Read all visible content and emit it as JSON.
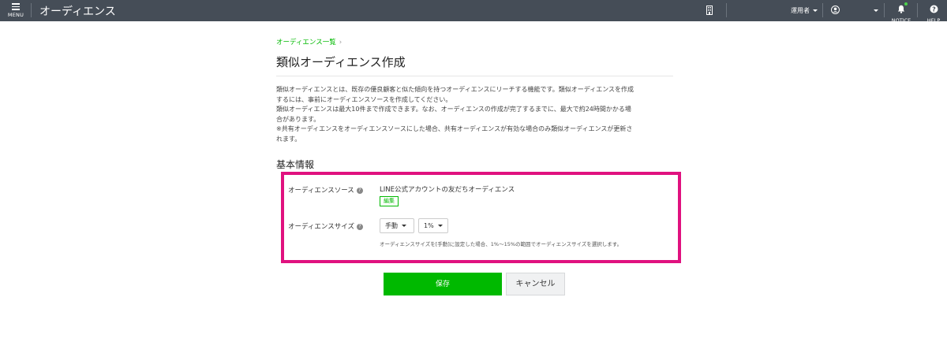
{
  "topbar": {
    "menu_label": "MENU",
    "app_title": "オーディエンス",
    "account_name": "運用者",
    "notice_label": "NOTICE",
    "help_label": "HELP",
    "icons": [
      "menu-icon",
      "building-icon",
      "user-icon",
      "bell-icon",
      "help-icon"
    ]
  },
  "breadcrumb": {
    "link": "オーディエンス一覧",
    "separator": "›"
  },
  "page": {
    "title": "類似オーディエンス作成",
    "description": [
      "類似オーディエンスとは、既存の優良顧客と似た傾向を持つオーディエンスにリーチする機能です。類似オーディエンスを作成",
      "するには、事前にオーディエンスソースを作成してください。",
      "類似オーディエンスは最大10件まで作成できます。なお、オーディエンスの作成が完了するまでに、最大で約24時間かかる場",
      "合があります。",
      "※共有オーディエンスをオーディエンスソースにした場合、共有オーディエンスが有効な場合のみ類似オーディエンスが更新さ",
      "れます。"
    ],
    "section_title": "基本情報"
  },
  "form": {
    "source_label": "オーディエンスソース",
    "source_value": "LINE公式アカウントの友だちオーディエンス",
    "edit_label": "編集",
    "size_label": "オーディエンスサイズ",
    "mode_value": "手動",
    "percent_value": "1%",
    "size_help": "オーディエンスサイズを[手動]に設定した場合、1%〜15%の範囲でオーディエンスサイズを選択します。",
    "help_glyph": "?"
  },
  "actions": {
    "save_label": "保存",
    "cancel_label": "キャンセル"
  },
  "colors": {
    "topbar": "#454d57",
    "accent": "#00b900",
    "highlight": "#e0117f"
  }
}
